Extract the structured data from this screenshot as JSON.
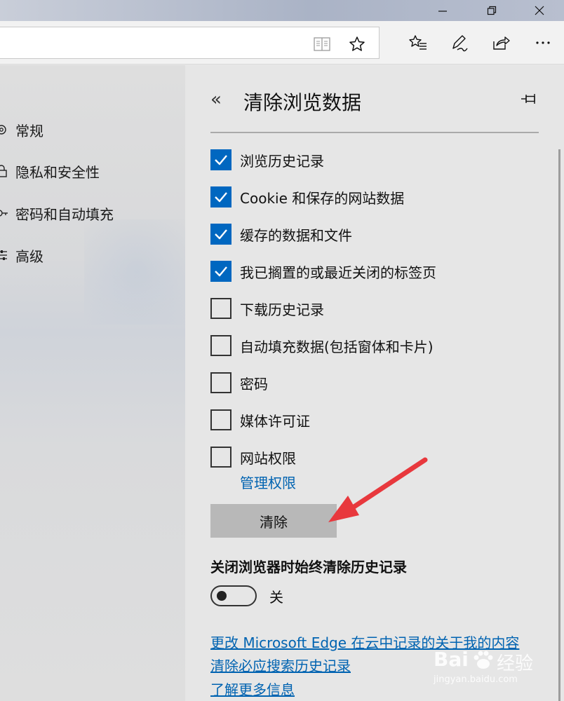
{
  "window": {
    "buttons": [
      "minimize",
      "restore",
      "close"
    ]
  },
  "toolbar": {
    "icons": [
      "reading-view-icon",
      "favorite-star-icon",
      "favorites-hub-icon",
      "web-note-pen-icon",
      "share-icon",
      "more-icon"
    ]
  },
  "sidebar": {
    "items": [
      {
        "label": "常规",
        "icon": "gear-icon"
      },
      {
        "label": "隐私和安全性",
        "icon": "lock-icon"
      },
      {
        "label": "密码和自动填充",
        "icon": "key-icon"
      },
      {
        "label": "高级",
        "icon": "sliders-icon"
      }
    ]
  },
  "panel": {
    "back_glyph": "«",
    "title": "清除浏览数据",
    "checkboxes": [
      {
        "label": "浏览历史记录",
        "checked": true
      },
      {
        "label": "Cookie 和保存的网站数据",
        "checked": true
      },
      {
        "label": "缓存的数据和文件",
        "checked": true
      },
      {
        "label": "我已搁置的或最近关闭的标签页",
        "checked": true
      },
      {
        "label": "下载历史记录",
        "checked": false
      },
      {
        "label": "自动填充数据(包括窗体和卡片)",
        "checked": false
      },
      {
        "label": "密码",
        "checked": false
      },
      {
        "label": "媒体许可证",
        "checked": false
      },
      {
        "label": "网站权限",
        "checked": false
      }
    ],
    "manage_link": "管理权限",
    "clear_button": "清除",
    "always_clear_label": "关闭浏览器时始终清除历史记录",
    "toggle": {
      "state_text": "关",
      "on": false
    },
    "links": [
      "更改 Microsoft Edge 在云中记录的关于我的内容",
      "清除必应搜索历史记录",
      "了解更多信息"
    ]
  },
  "watermark": {
    "brand": "Bai",
    "brand2": "经验",
    "url": "jingyan.baidu.com"
  },
  "colors": {
    "accent": "#0067c0",
    "link": "#0063b1",
    "arrow": "#e8383d"
  }
}
